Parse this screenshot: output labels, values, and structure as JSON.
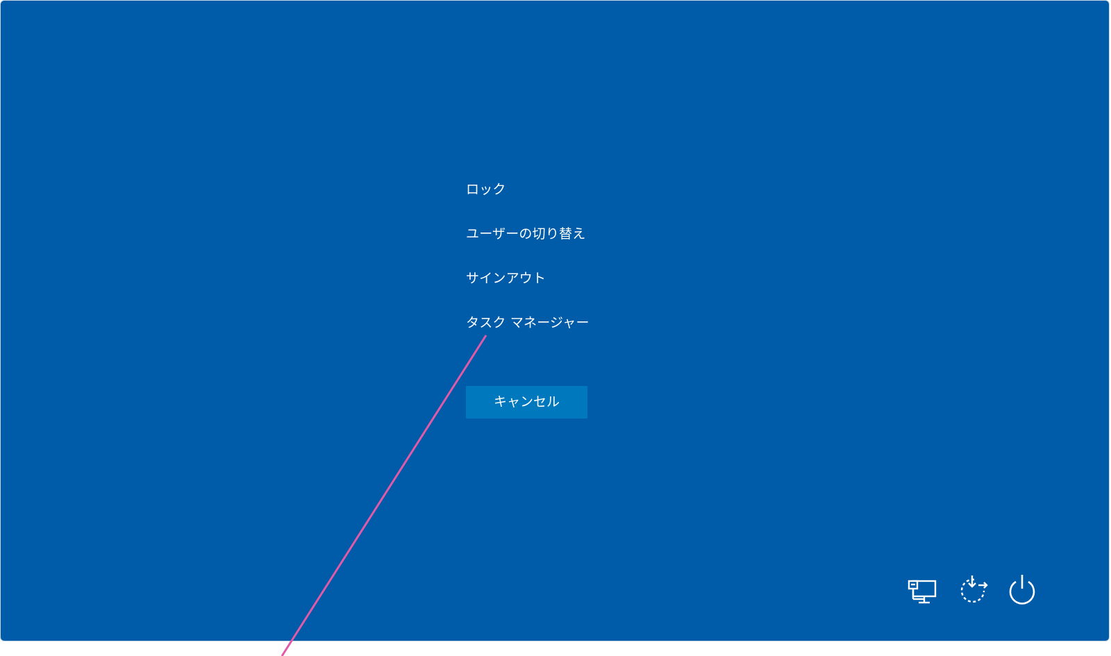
{
  "menu": {
    "items": [
      {
        "label": "ロック"
      },
      {
        "label": "ユーザーの切り替え"
      },
      {
        "label": "サインアウト"
      },
      {
        "label": "タスク マネージャー"
      }
    ]
  },
  "cancel": {
    "label": "キャンセル"
  },
  "tray": {
    "icons": [
      "network-icon",
      "accessibility-icon",
      "power-icon"
    ]
  },
  "colors": {
    "background": "#005ca8",
    "button": "#0078be",
    "text": "#ffffff",
    "annotation": "#e05aa8"
  }
}
